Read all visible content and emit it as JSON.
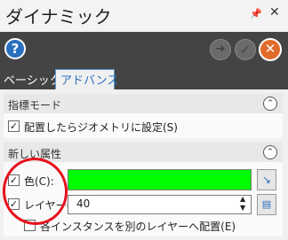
{
  "window": {
    "title": "ダイナミック",
    "pin_glyph": "📌",
    "close_glyph": "✕"
  },
  "toolbar": {
    "help_glyph": "?",
    "apply_glyph": "➜",
    "ok_glyph": "✓",
    "cancel_glyph": "✕"
  },
  "tabs": [
    {
      "label": "ベーシック",
      "active": false
    },
    {
      "label": "アドバンス",
      "active": true
    }
  ],
  "sections": {
    "guide_mode": {
      "title": "指標モード",
      "collapse_glyph": "⌃",
      "set_to_geometry": {
        "label": "配置したらジオメトリに設定(S)",
        "checked": true
      }
    },
    "new_attributes": {
      "title": "新しい属性",
      "collapse_glyph": "⌃",
      "color": {
        "label": "色(C):",
        "checked": true,
        "value_color": "#00ff00"
      },
      "layer": {
        "label": "レイヤー(L):",
        "checked": true,
        "value": "40"
      },
      "each_instance": {
        "label": "各インスタンスを別のレイヤーへ配置(E)",
        "checked": false
      }
    }
  },
  "glyphs": {
    "check": "✓",
    "spin_up": "▲",
    "spin_down": "▼",
    "picker": "↘",
    "layer_icon": "▤"
  },
  "colors": {
    "accent": "#2a6fbd",
    "cancel": "#e06a2a",
    "swatch": "#00ff00",
    "annotation": "#e8101c"
  }
}
